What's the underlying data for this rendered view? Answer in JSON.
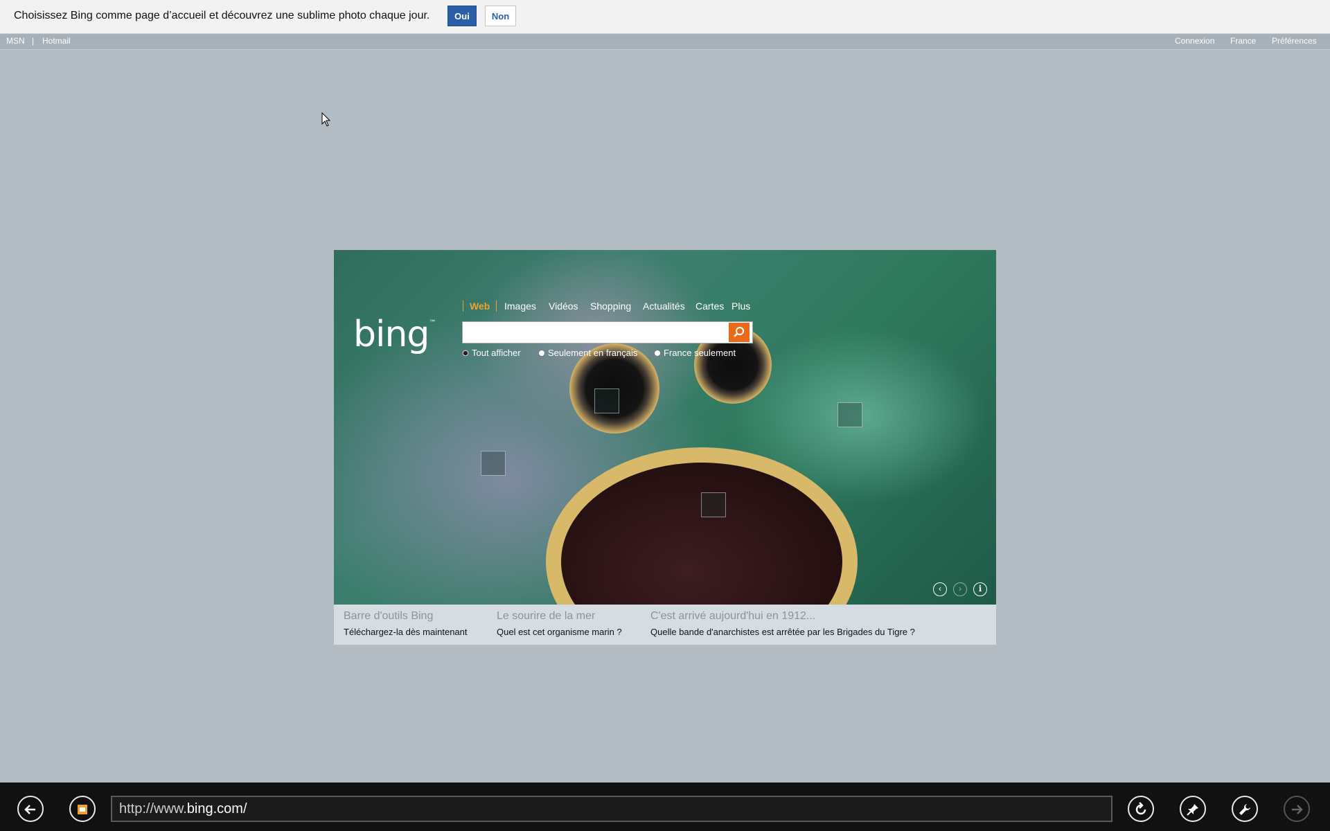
{
  "notification": {
    "message": "Choisissez Bing comme page d’accueil et découvrez une sublime photo chaque jour.",
    "yes_label": "Oui",
    "no_label": "Non"
  },
  "topbar": {
    "left_links": [
      "MSN",
      "|",
      "Hotmail"
    ],
    "right_links": [
      "Connexion",
      "France",
      "Préférences"
    ]
  },
  "search": {
    "logo": "bing",
    "scopes": [
      "Web",
      "Images",
      "Vidéos",
      "Shopping",
      "Actualités",
      "Cartes",
      "Plus"
    ],
    "active_scope": "Web",
    "query": "",
    "radio_options": [
      "Tout afficher",
      "Seulement en français",
      "France seulement"
    ],
    "selected_radio": "Tout afficher",
    "search_icon": "magnifier-icon"
  },
  "strip": [
    {
      "title": "Barre d'outils Bing",
      "desc": "Téléchargez-la dès maintenant"
    },
    {
      "title": "Le sourire de la mer",
      "desc": "Quel est cet organisme marin ?"
    },
    {
      "title": "C'est arrivé aujourd'hui en 1912...",
      "desc": "Quelle bande d'anarchistes est arrêtée par les Brigades du Tigre ?"
    }
  ],
  "browser": {
    "url_prefix": "http://www.",
    "url_domain": "bing.com/",
    "icons": [
      "back-icon",
      "favicon-tab-icon",
      "refresh-icon",
      "pin-icon",
      "wrench-icon",
      "forward-icon"
    ]
  },
  "colors": {
    "accent": "#f0a030",
    "search_button": "#e86a1a",
    "yes_button": "#2a5fa8"
  }
}
